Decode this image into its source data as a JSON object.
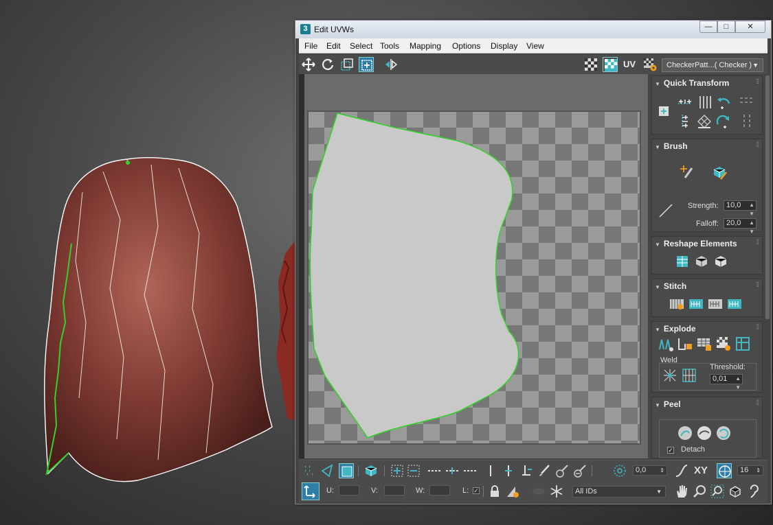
{
  "window": {
    "app_icon_label": "3",
    "title": "Edit UVWs",
    "min_glyph": "—",
    "max_glyph": "□",
    "close_glyph": "✕"
  },
  "menu": {
    "items": [
      "File",
      "Edit",
      "Select",
      "Tools",
      "Mapping",
      "Options",
      "Display",
      "View"
    ]
  },
  "toolbar": {
    "uv_label": "UV",
    "texture_select": "CheckerPatt...( Checker )"
  },
  "panel": {
    "quick_transform": "Quick Transform",
    "brush": "Brush",
    "strength_label": "Strength:",
    "strength_value": "10,0",
    "falloff_label": "Falloff:",
    "falloff_value": "20,0",
    "reshape": "Reshape Elements",
    "stitch": "Stitch",
    "explode": "Explode",
    "weld_label": "Weld",
    "threshold_label": "Threshold:",
    "threshold_value": "0,01",
    "peel": "Peel",
    "detach_label": "Detach",
    "detach_checked": true
  },
  "bottom": {
    "rotate_value": "0,0",
    "xy_label": "XY",
    "grid_value": "16",
    "u_label": "U:",
    "v_label": "V:",
    "w_label": "W:",
    "l_label": "L:",
    "id_filter": "All IDs"
  },
  "colors": {
    "accent_teal": "#3fb8c4",
    "selection_green": "#35d12a",
    "mesh_white": "#ffffff",
    "model_red": "#8a3b33"
  }
}
